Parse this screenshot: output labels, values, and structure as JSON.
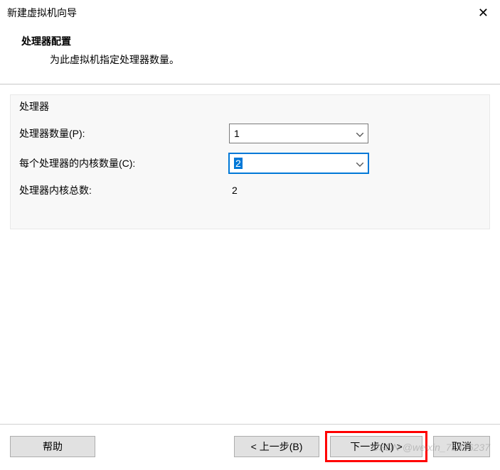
{
  "window": {
    "title": "新建虚拟机向导"
  },
  "header": {
    "title": "处理器配置",
    "subtitle": "为此虚拟机指定处理器数量。"
  },
  "group": {
    "label": "处理器"
  },
  "fields": {
    "processor_count": {
      "label": "处理器数量(P):",
      "value": "1"
    },
    "cores_per_processor": {
      "label": "每个处理器的内核数量(C):",
      "value": "2"
    },
    "total_cores": {
      "label": "处理器内核总数:",
      "value": "2"
    }
  },
  "buttons": {
    "help": "帮助",
    "back": "< 上一步(B)",
    "next": "下一步(N) >",
    "cancel": "取消"
  },
  "watermark": "CSDN @weixin_71436237"
}
